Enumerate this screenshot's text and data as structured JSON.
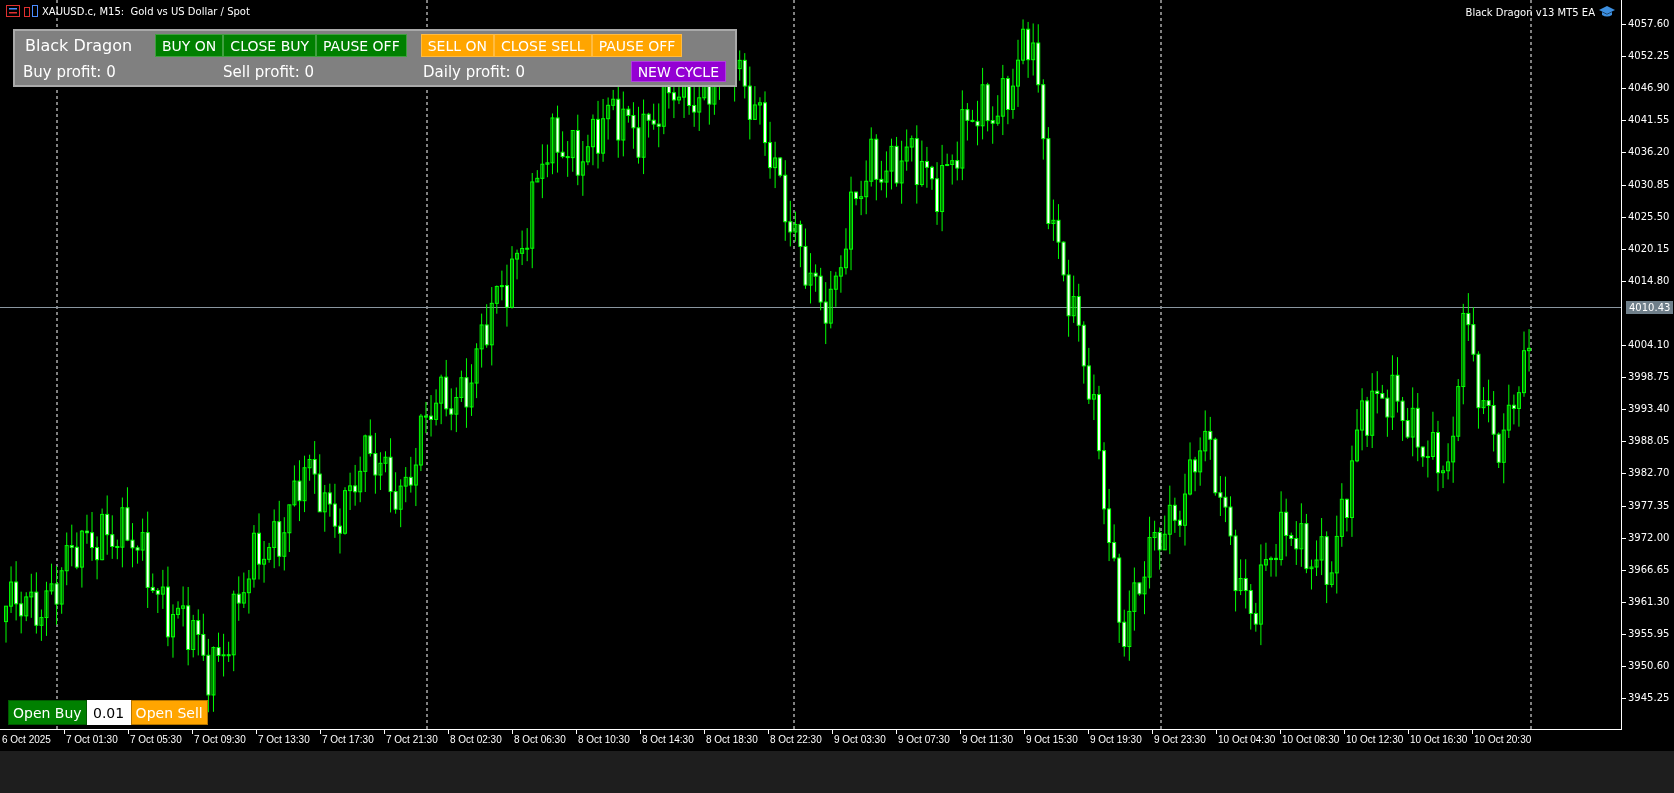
{
  "chart_header": {
    "symbol": "XAUUSD.c, M15:  Gold vs US Dollar / Spot",
    "expert": "Black Dragon v13 MT5 EA"
  },
  "panel": {
    "title": "Black Dragon",
    "button_groups": [
      [
        {
          "label": "BUY ON",
          "color": "#008000"
        },
        {
          "label": "CLOSE BUY",
          "color": "#008000"
        },
        {
          "label": "PAUSE OFF",
          "color": "#008000"
        }
      ],
      [
        {
          "label": "SELL ON",
          "color": "#ffa500"
        },
        {
          "label": "CLOSE SELL",
          "color": "#ffa500"
        },
        {
          "label": "PAUSE OFF",
          "color": "#ffa500"
        }
      ]
    ],
    "profits": [
      "Buy profit: 0",
      "Sell profit: 0",
      "Daily profit: 0"
    ],
    "new_cycle": {
      "label": "NEW CYCLE",
      "color": "#9400d3"
    }
  },
  "trade_bar": {
    "buy": "Open Buy",
    "lot": "0.01",
    "sell": "Open Sell"
  },
  "price_axis": {
    "labels": [
      "4057.60",
      "4052.25",
      "4046.90",
      "4041.55",
      "4036.20",
      "4030.85",
      "4025.50",
      "4020.15",
      "4014.80",
      "4004.10",
      "3998.75",
      "3993.40",
      "3988.05",
      "3982.70",
      "3977.35",
      "3972.00",
      "3966.65",
      "3961.30",
      "3955.95",
      "3950.60",
      "3945.25"
    ],
    "current_price": "4010.43"
  },
  "time_axis": {
    "labels": [
      "6 Oct 2025",
      "7 Oct 01:30",
      "7 Oct 05:30",
      "7 Oct 09:30",
      "7 Oct 13:30",
      "7 Oct 17:30",
      "7 Oct 21:30",
      "8 Oct 02:30",
      "8 Oct 06:30",
      "8 Oct 10:30",
      "8 Oct 14:30",
      "8 Oct 18:30",
      "8 Oct 22:30",
      "9 Oct 03:30",
      "9 Oct 07:30",
      "9 Oct 11:30",
      "9 Oct 15:30",
      "9 Oct 19:30",
      "9 Oct 23:30",
      "10 Oct 04:30",
      "10 Oct 08:30",
      "10 Oct 12:30",
      "10 Oct 16:30",
      "10 Oct 20:30"
    ]
  }
}
